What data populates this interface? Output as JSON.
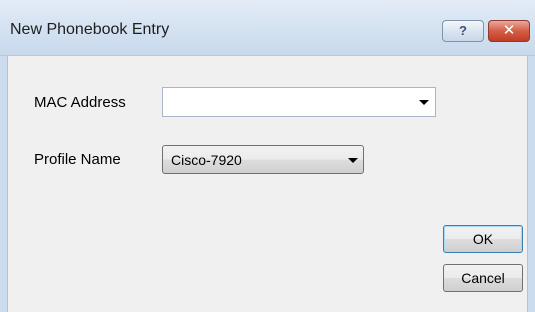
{
  "window": {
    "title": "New Phonebook Entry",
    "help_glyph": "?",
    "close_glyph": "✕"
  },
  "form": {
    "mac_label": "MAC Address",
    "mac_value": "",
    "profile_label": "Profile Name",
    "profile_value": "Cisco-7920"
  },
  "buttons": {
    "ok_label": "OK",
    "cancel_label": "Cancel"
  },
  "icons": {
    "help": "help-icon",
    "close": "close-icon",
    "dropdown": "chevron-down-icon"
  }
}
